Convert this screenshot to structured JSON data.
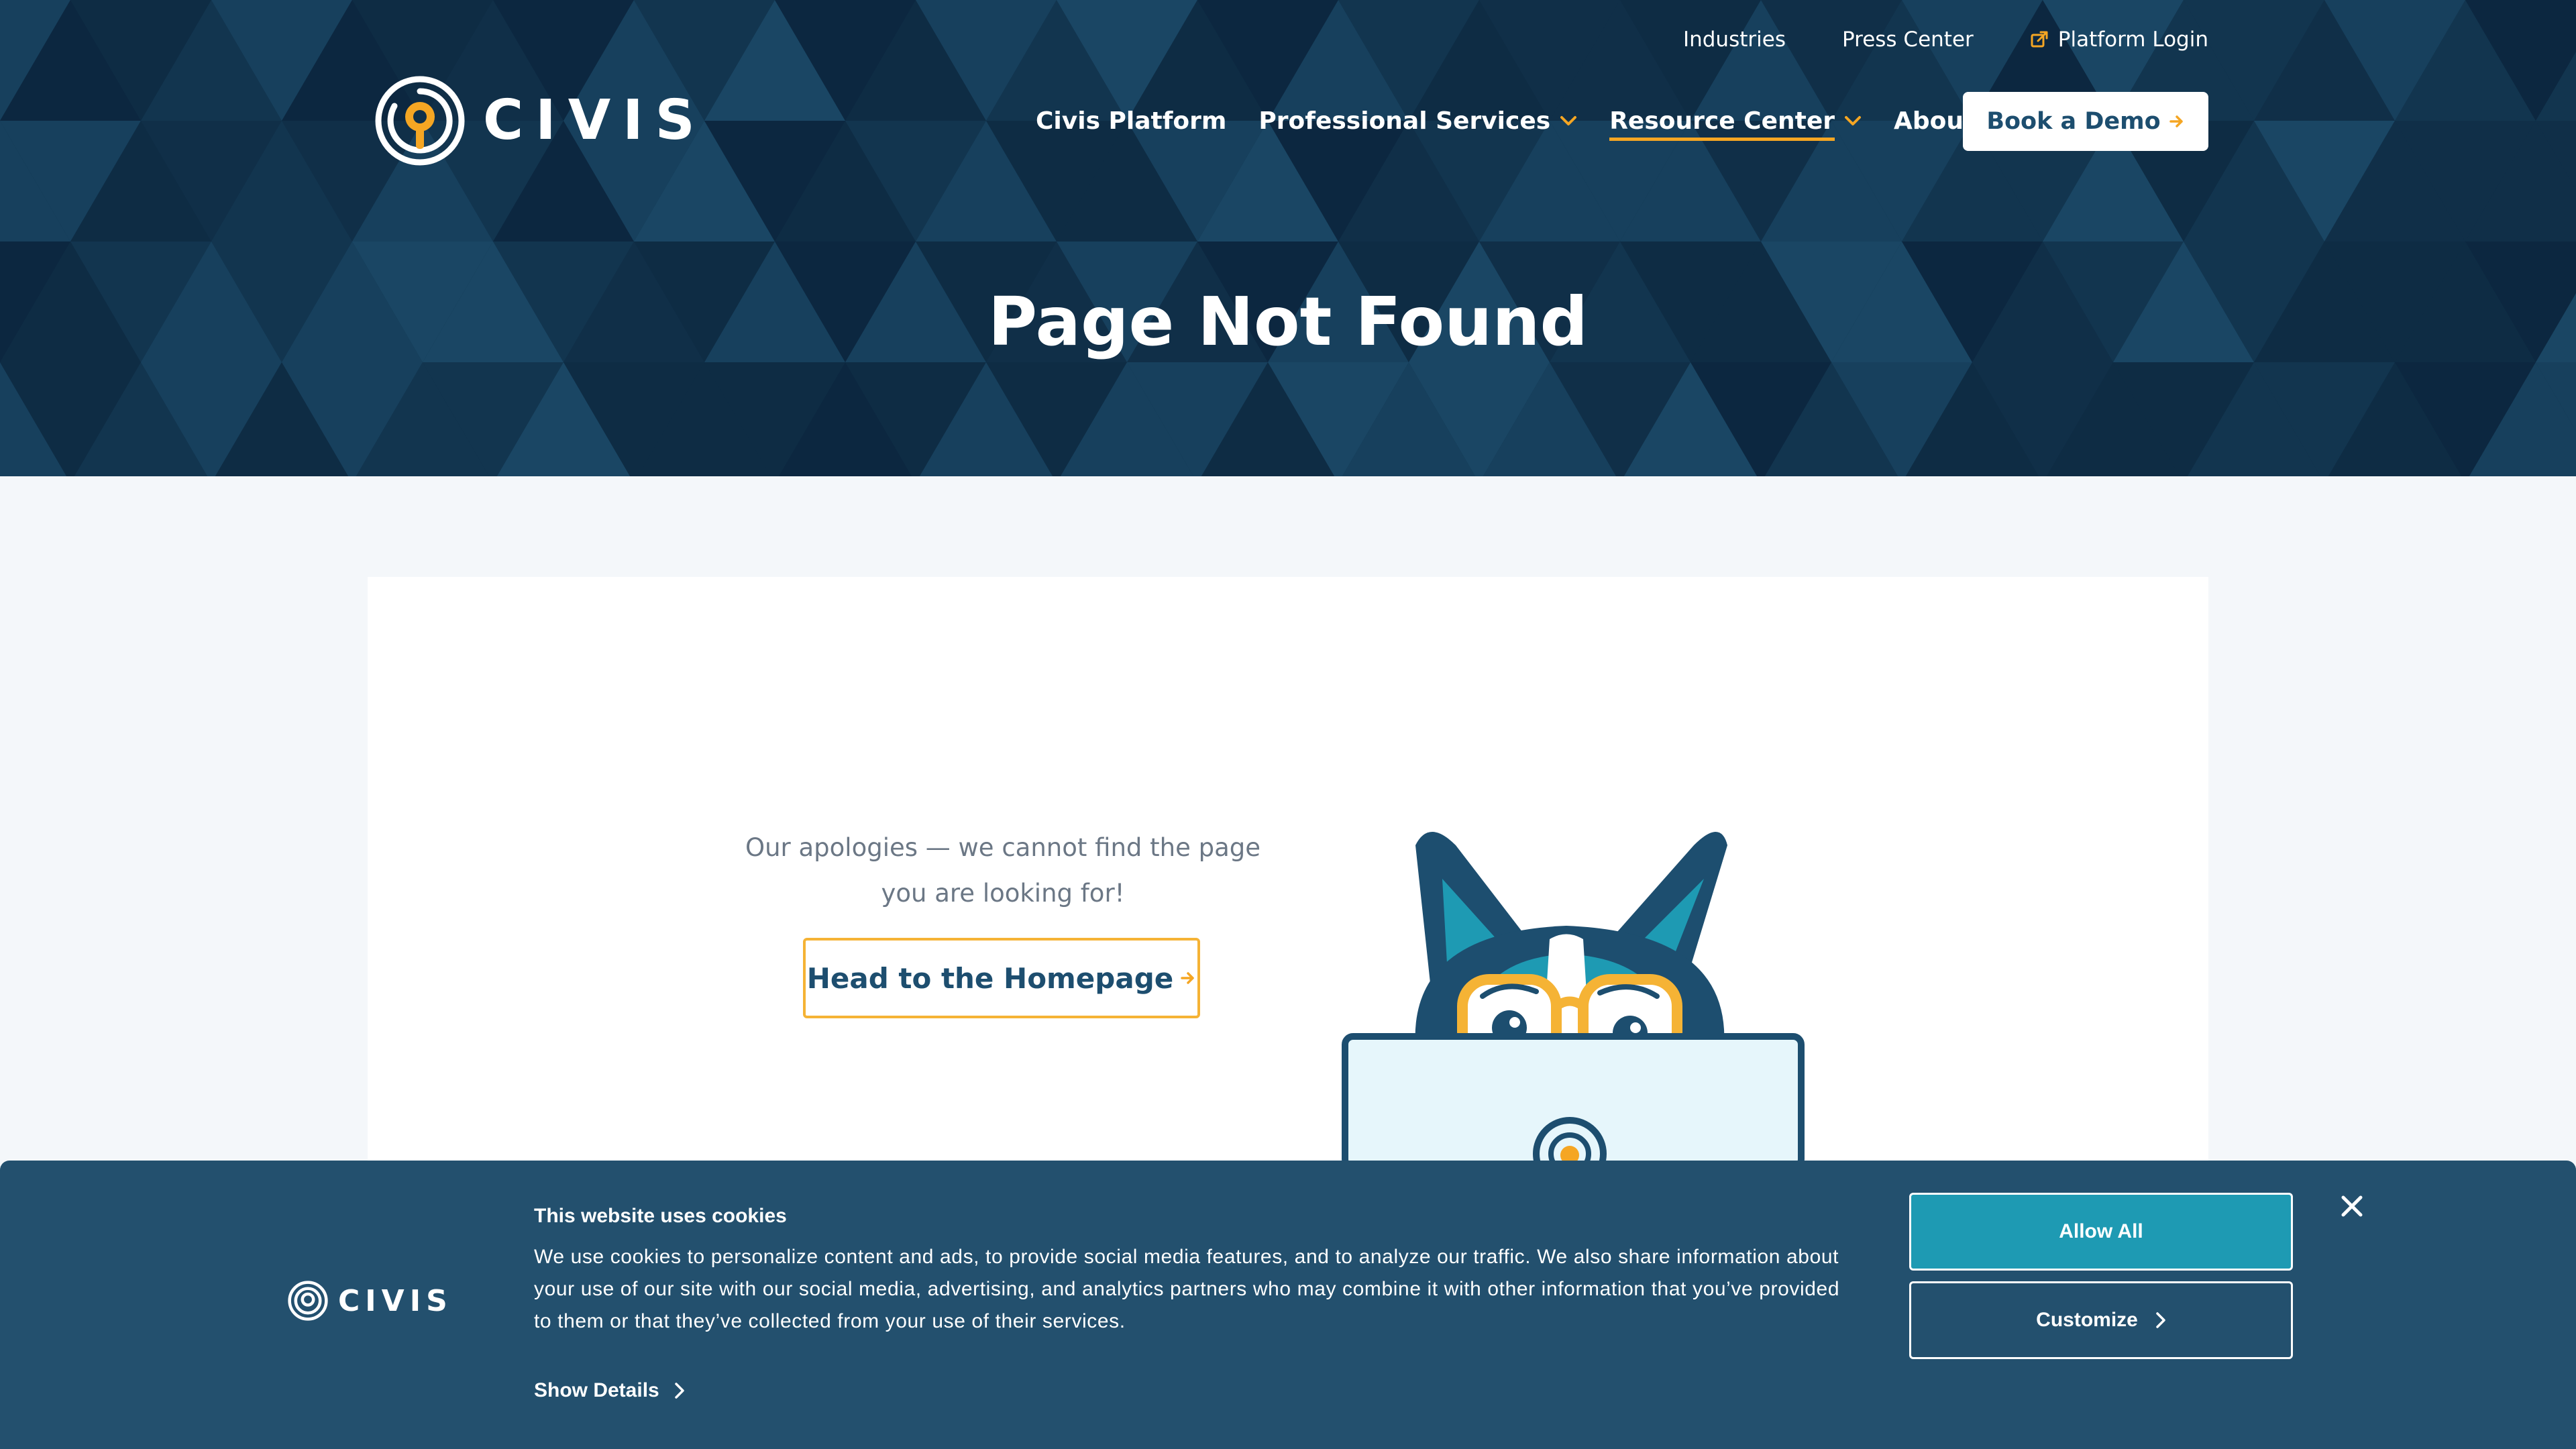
{
  "brand": {
    "name": "CIVIS",
    "colors": {
      "navy": "#0f3049",
      "accent": "#f5a623",
      "teal": "#1e9ab3",
      "banner": "#23506e",
      "text_dark": "#1d4e6f"
    }
  },
  "utility_nav": {
    "items": [
      {
        "label": "Industries"
      },
      {
        "label": "Press Center"
      },
      {
        "label": "Platform Login",
        "icon": "external-link-icon"
      }
    ]
  },
  "main_nav": {
    "items": [
      {
        "label": "Civis Platform",
        "has_dropdown": false,
        "active": false
      },
      {
        "label": "Professional Services",
        "has_dropdown": true,
        "active": false
      },
      {
        "label": "Resource Center",
        "has_dropdown": true,
        "active": true
      },
      {
        "label": "About",
        "has_dropdown": true,
        "active": false
      }
    ],
    "search_icon": "search-icon",
    "cta_label": "Book a Demo"
  },
  "hero": {
    "title": "Page Not Found"
  },
  "content": {
    "apology_line1": "Our apologies — we cannot find the page",
    "apology_line2": "you are looking for!",
    "home_button_label": "Head to the Homepage"
  },
  "cookie_banner": {
    "title": "This website uses cookies",
    "body": "We use cookies to personalize content and ads, to provide social media features, and to analyze our traffic. We also share information about your use of our site with our social media, advertising, and analytics partners who may combine it with other information that you’ve provided to them or that they’ve collected from your use of their services.",
    "show_details_label": "Show Details",
    "allow_all_label": "Allow All",
    "customize_label": "Customize",
    "close_icon": "close-icon"
  }
}
